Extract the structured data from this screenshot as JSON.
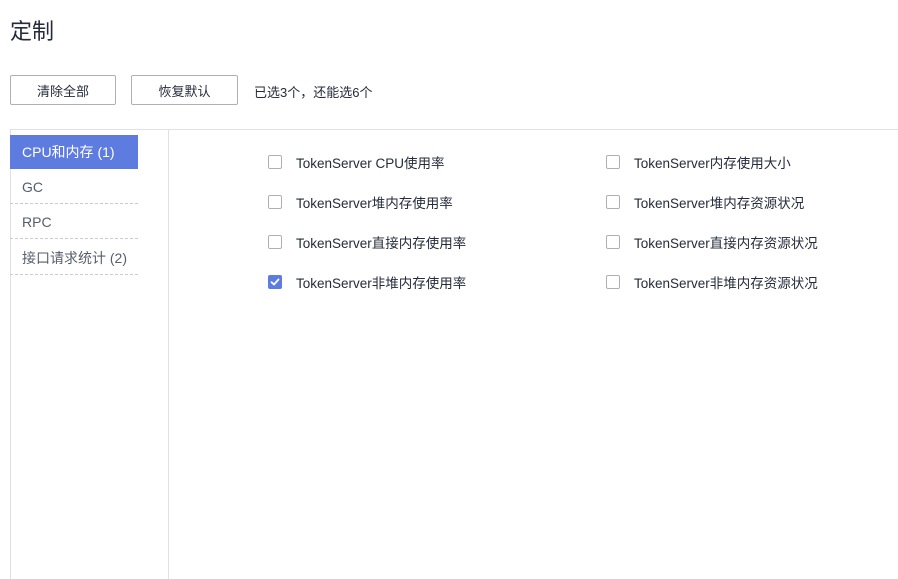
{
  "page": {
    "title": "定制"
  },
  "toolbar": {
    "clear_label": "清除全部",
    "reset_label": "恢复默认",
    "selection_info": "已选3个，还能选6个"
  },
  "sidebar": {
    "items": [
      {
        "label": "CPU和内存 (1)",
        "active": true
      },
      {
        "label": "GC",
        "active": false
      },
      {
        "label": "RPC",
        "active": false
      },
      {
        "label": "接口请求统计 (2)",
        "active": false
      }
    ]
  },
  "metrics": {
    "left": [
      {
        "label": "TokenServer CPU使用率",
        "checked": false
      },
      {
        "label": "TokenServer堆内存使用率",
        "checked": false
      },
      {
        "label": "TokenServer直接内存使用率",
        "checked": false
      },
      {
        "label": "TokenServer非堆内存使用率",
        "checked": true
      }
    ],
    "right": [
      {
        "label": "TokenServer内存使用大小",
        "checked": false
      },
      {
        "label": "TokenServer堆内存资源状况",
        "checked": false
      },
      {
        "label": "TokenServer直接内存资源状况",
        "checked": false
      },
      {
        "label": "TokenServer非堆内存资源状况",
        "checked": false
      }
    ]
  },
  "colors": {
    "accent": "#5e7ce0",
    "border": "#dfe1e6",
    "text": "#252b3a"
  }
}
